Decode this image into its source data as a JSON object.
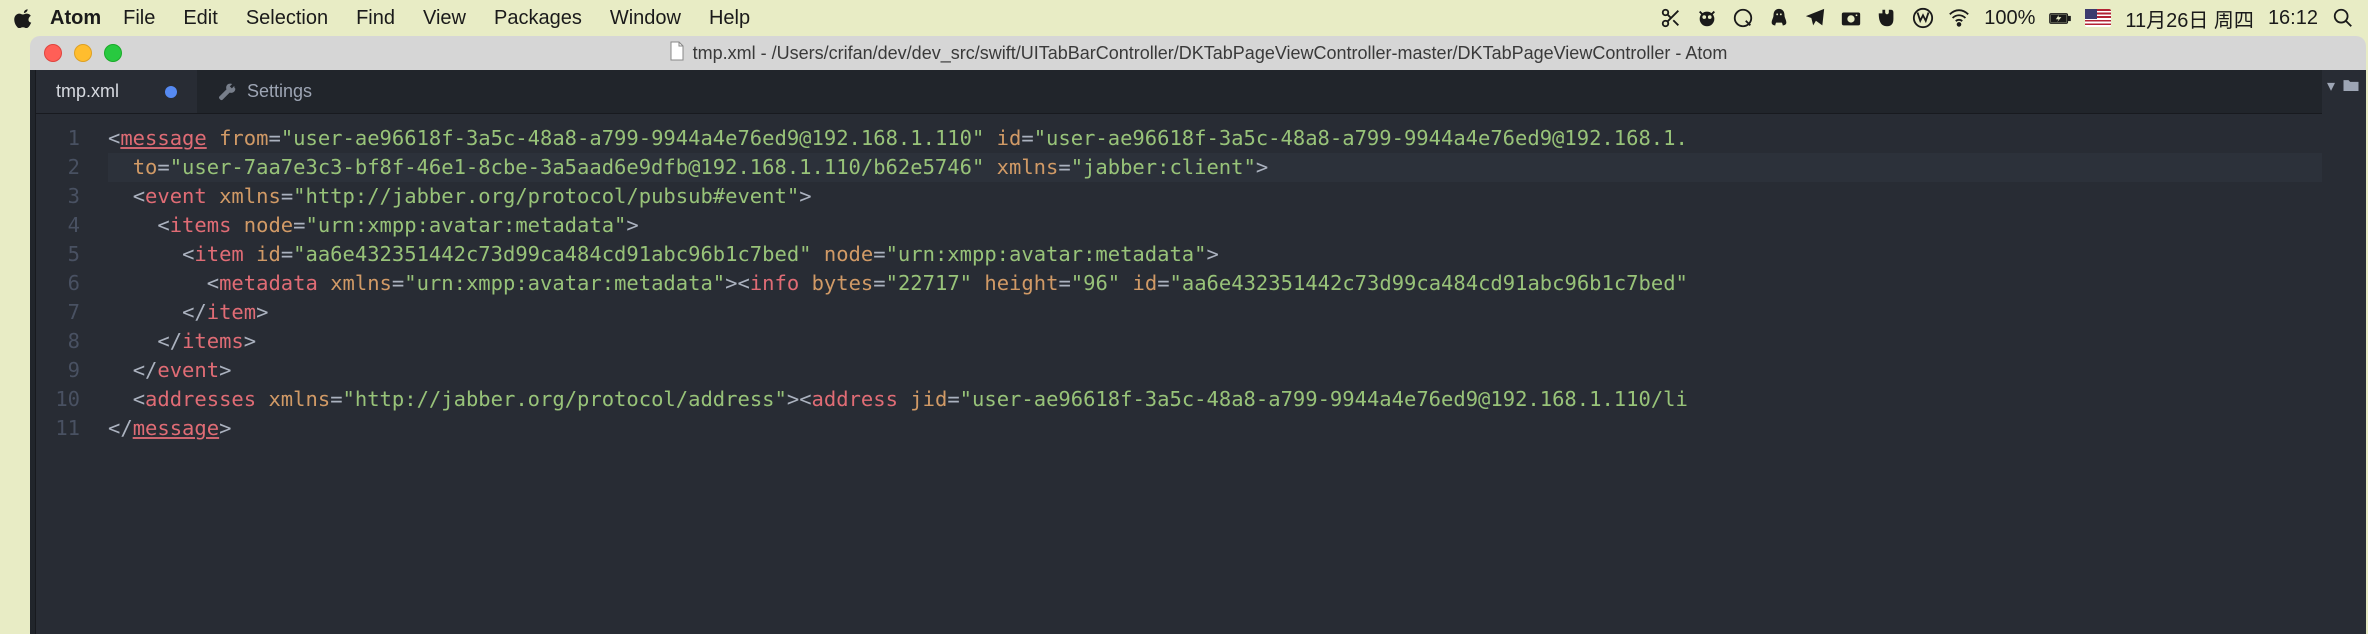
{
  "menubar": {
    "app": "Atom",
    "items": [
      "File",
      "Edit",
      "Selection",
      "Find",
      "View",
      "Packages",
      "Window",
      "Help"
    ],
    "battery_pct": "100%",
    "date": "11月26日 周四",
    "time": "16:12"
  },
  "window": {
    "title": "tmp.xml - /Users/crifan/dev/dev_src/swift/UITabBarController/DKTabPageViewController-master/DKTabPageViewController - Atom"
  },
  "tabs": {
    "active": "tmp.xml",
    "modified": true,
    "other": "Settings"
  },
  "code": {
    "line_numbers": [
      "1",
      "2",
      "3",
      "4",
      "5",
      "6",
      "7",
      "8",
      "9",
      "10",
      "11"
    ],
    "highlighted_line": 2,
    "lines": [
      {
        "indent": 0,
        "tokens": [
          {
            "t": "<",
            "c": "p-bracket"
          },
          {
            "t": "message",
            "c": "p-tag underline"
          },
          {
            "t": " ",
            "c": "p-white"
          },
          {
            "t": "from",
            "c": "p-attr"
          },
          {
            "t": "=",
            "c": "p-white"
          },
          {
            "t": "\"user-ae96618f-3a5c-48a8-a799-9944a4e76ed9@192.168.1.110\"",
            "c": "p-str"
          },
          {
            "t": " ",
            "c": "p-white"
          },
          {
            "t": "id",
            "c": "p-attr"
          },
          {
            "t": "=",
            "c": "p-white"
          },
          {
            "t": "\"user-ae96618f-3a5c-48a8-a799-9944a4e76ed9@192.168.1.",
            "c": "p-str"
          }
        ]
      },
      {
        "indent": 1,
        "tokens": [
          {
            "t": "to",
            "c": "p-attr"
          },
          {
            "t": "=",
            "c": "p-white"
          },
          {
            "t": "\"user-7aa7e3c3-bf8f-46e1-8cbe-3a5aad6e9dfb@192.168.1.110/b62e5746\"",
            "c": "p-str"
          },
          {
            "t": " ",
            "c": "p-white"
          },
          {
            "t": "xmlns",
            "c": "p-attr"
          },
          {
            "t": "=",
            "c": "p-white"
          },
          {
            "t": "\"jabber:client\"",
            "c": "p-str"
          },
          {
            "t": ">",
            "c": "p-bracket"
          }
        ]
      },
      {
        "indent": 1,
        "tokens": [
          {
            "t": "<",
            "c": "p-bracket"
          },
          {
            "t": "event",
            "c": "p-tag"
          },
          {
            "t": " ",
            "c": "p-white"
          },
          {
            "t": "xmlns",
            "c": "p-attr"
          },
          {
            "t": "=",
            "c": "p-white"
          },
          {
            "t": "\"http://jabber.org/protocol/pubsub#event\"",
            "c": "p-str"
          },
          {
            "t": ">",
            "c": "p-bracket"
          }
        ]
      },
      {
        "indent": 2,
        "tokens": [
          {
            "t": "<",
            "c": "p-bracket"
          },
          {
            "t": "items",
            "c": "p-tag"
          },
          {
            "t": " ",
            "c": "p-white"
          },
          {
            "t": "node",
            "c": "p-attr"
          },
          {
            "t": "=",
            "c": "p-white"
          },
          {
            "t": "\"urn:xmpp:avatar:metadata\"",
            "c": "p-str"
          },
          {
            "t": ">",
            "c": "p-bracket"
          }
        ]
      },
      {
        "indent": 3,
        "tokens": [
          {
            "t": "<",
            "c": "p-bracket"
          },
          {
            "t": "item",
            "c": "p-tag"
          },
          {
            "t": " ",
            "c": "p-white"
          },
          {
            "t": "id",
            "c": "p-attr"
          },
          {
            "t": "=",
            "c": "p-white"
          },
          {
            "t": "\"aa6e432351442c73d99ca484cd91abc96b1c7bed\"",
            "c": "p-str"
          },
          {
            "t": " ",
            "c": "p-white"
          },
          {
            "t": "node",
            "c": "p-attr"
          },
          {
            "t": "=",
            "c": "p-white"
          },
          {
            "t": "\"urn:xmpp:avatar:metadata\"",
            "c": "p-str"
          },
          {
            "t": ">",
            "c": "p-bracket"
          }
        ]
      },
      {
        "indent": 4,
        "tokens": [
          {
            "t": "<",
            "c": "p-bracket"
          },
          {
            "t": "metadata",
            "c": "p-tag"
          },
          {
            "t": " ",
            "c": "p-white"
          },
          {
            "t": "xmlns",
            "c": "p-attr"
          },
          {
            "t": "=",
            "c": "p-white"
          },
          {
            "t": "\"urn:xmpp:avatar:metadata\"",
            "c": "p-str"
          },
          {
            "t": "><",
            "c": "p-bracket"
          },
          {
            "t": "info",
            "c": "p-tag"
          },
          {
            "t": " ",
            "c": "p-white"
          },
          {
            "t": "bytes",
            "c": "p-attr"
          },
          {
            "t": "=",
            "c": "p-white"
          },
          {
            "t": "\"22717\"",
            "c": "p-str"
          },
          {
            "t": " ",
            "c": "p-white"
          },
          {
            "t": "height",
            "c": "p-attr"
          },
          {
            "t": "=",
            "c": "p-white"
          },
          {
            "t": "\"96\"",
            "c": "p-str"
          },
          {
            "t": " ",
            "c": "p-white"
          },
          {
            "t": "id",
            "c": "p-attr"
          },
          {
            "t": "=",
            "c": "p-white"
          },
          {
            "t": "\"aa6e432351442c73d99ca484cd91abc96b1c7bed\"",
            "c": "p-str"
          }
        ]
      },
      {
        "indent": 3,
        "tokens": [
          {
            "t": "</",
            "c": "p-bracket"
          },
          {
            "t": "item",
            "c": "p-tag"
          },
          {
            "t": ">",
            "c": "p-bracket"
          }
        ]
      },
      {
        "indent": 2,
        "tokens": [
          {
            "t": "</",
            "c": "p-bracket"
          },
          {
            "t": "items",
            "c": "p-tag"
          },
          {
            "t": ">",
            "c": "p-bracket"
          }
        ]
      },
      {
        "indent": 1,
        "tokens": [
          {
            "t": "</",
            "c": "p-bracket"
          },
          {
            "t": "event",
            "c": "p-tag"
          },
          {
            "t": ">",
            "c": "p-bracket"
          }
        ]
      },
      {
        "indent": 1,
        "tokens": [
          {
            "t": "<",
            "c": "p-bracket"
          },
          {
            "t": "addresses",
            "c": "p-tag"
          },
          {
            "t": " ",
            "c": "p-white"
          },
          {
            "t": "xmlns",
            "c": "p-attr"
          },
          {
            "t": "=",
            "c": "p-white"
          },
          {
            "t": "\"http://jabber.org/protocol/address\"",
            "c": "p-str"
          },
          {
            "t": "><",
            "c": "p-bracket"
          },
          {
            "t": "address",
            "c": "p-tag"
          },
          {
            "t": " ",
            "c": "p-white"
          },
          {
            "t": "jid",
            "c": "p-attr"
          },
          {
            "t": "=",
            "c": "p-white"
          },
          {
            "t": "\"user-ae96618f-3a5c-48a8-a799-9944a4e76ed9@192.168.1.110/li",
            "c": "p-str"
          }
        ]
      },
      {
        "indent": 0,
        "tokens": [
          {
            "t": "</",
            "c": "p-bracket"
          },
          {
            "t": "message",
            "c": "p-tag underline"
          },
          {
            "t": ">",
            "c": "p-bracket"
          }
        ]
      }
    ]
  }
}
